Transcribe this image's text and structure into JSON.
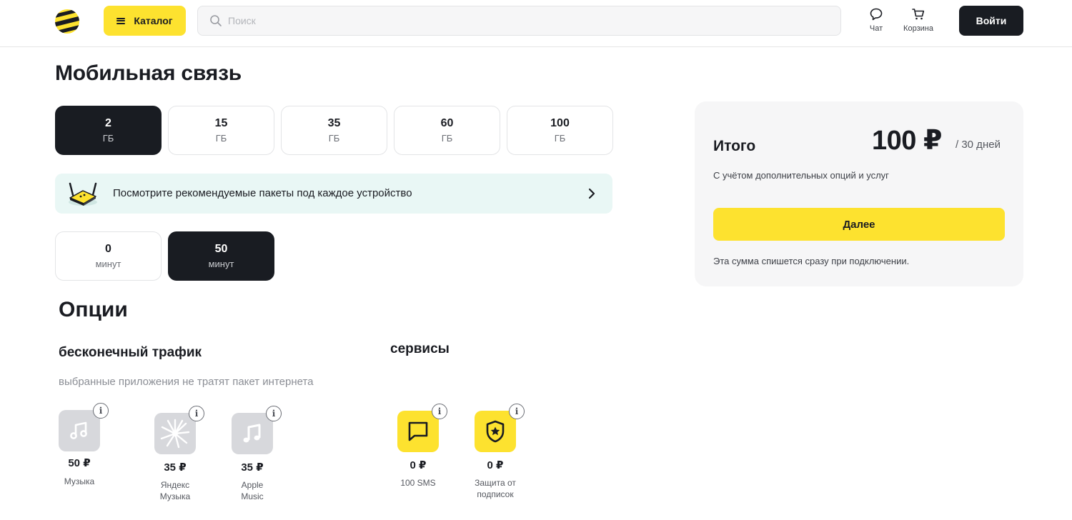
{
  "header": {
    "logo_icon": "beeline-logo",
    "catalog_label": "Каталог",
    "search_placeholder": "Поиск",
    "chat_label": "Чат",
    "cart_label": "Корзина",
    "login_label": "Войти"
  },
  "page_title": "Мобильная связь",
  "data_packages": [
    {
      "value": "2",
      "unit": "ГБ",
      "selected": true
    },
    {
      "value": "15",
      "unit": "ГБ",
      "selected": false
    },
    {
      "value": "35",
      "unit": "ГБ",
      "selected": false
    },
    {
      "value": "60",
      "unit": "ГБ",
      "selected": false
    },
    {
      "value": "100",
      "unit": "ГБ",
      "selected": false
    }
  ],
  "banner": {
    "text": "Посмотрите рекомендуемые пакеты под каждое устройство"
  },
  "minute_packages": [
    {
      "value": "0",
      "unit": "минут",
      "selected": false
    },
    {
      "value": "50",
      "unit": "минут",
      "selected": true
    }
  ],
  "options": {
    "title": "Опции",
    "traffic": {
      "title": "бесконечный трафик",
      "description": "выбранные приложения не тратят пакет интернета",
      "items": [
        {
          "price": "50 ₽",
          "label": "Музыка",
          "icon": "music-note-icon"
        },
        {
          "price": "35 ₽",
          "label": "Яндекс Музыка",
          "icon": "yandex-music-icon"
        },
        {
          "price": "35 ₽",
          "label": "Apple Music",
          "icon": "apple-music-icon"
        }
      ]
    },
    "services": {
      "title": "сервисы",
      "items": [
        {
          "price": "0 ₽",
          "label": "100 SMS",
          "icon": "message-icon"
        },
        {
          "price": "0 ₽",
          "label": "Защита от подписок",
          "icon": "shield-star-icon"
        }
      ]
    }
  },
  "summary": {
    "label": "Итого",
    "amount": "100 ₽",
    "period": "/ 30 дней",
    "note": "С учётом дополнительных опций и услуг",
    "button_label": "Далее",
    "footnote": "Эта сумма спишется сразу при подключении."
  },
  "colors": {
    "accent_yellow": "#fde22f",
    "dark": "#191c22",
    "banner_bg": "#e9f7f5",
    "card_bg": "#f6f6f7"
  }
}
